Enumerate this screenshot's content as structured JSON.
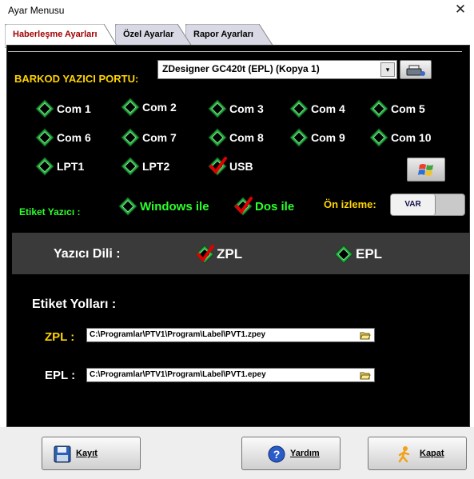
{
  "window": {
    "title": "Ayar Menusu",
    "close_glyph": "✕"
  },
  "tabs": [
    {
      "label": "Haberleşme Ayarları"
    },
    {
      "label": "Özel Ayarlar"
    },
    {
      "label": "Rapor Ayarları"
    }
  ],
  "port": {
    "label": "BARKOD YAZICI PORTU:",
    "selected": "ZDesigner GC420t (EPL) (Kopya 1)",
    "dropdown_glyph": "▾"
  },
  "ports": [
    {
      "label": "Com 1",
      "checked": false
    },
    {
      "label": "Com 2",
      "checked": false
    },
    {
      "label": "Com 3",
      "checked": false
    },
    {
      "label": "Com 4",
      "checked": false
    },
    {
      "label": "Com 5",
      "checked": false
    },
    {
      "label": "Com 6",
      "checked": false
    },
    {
      "label": "Com 7",
      "checked": false
    },
    {
      "label": "Com 8",
      "checked": false
    },
    {
      "label": "Com 9",
      "checked": false
    },
    {
      "label": "Com 10",
      "checked": false
    },
    {
      "label": "LPT1",
      "checked": false
    },
    {
      "label": "LPT2",
      "checked": false
    },
    {
      "label": "USB",
      "checked": true
    }
  ],
  "printer_mode": {
    "label": "Etiket Yazıcı :",
    "windows": {
      "label": "Windows ile",
      "checked": false
    },
    "dos": {
      "label": "Dos ile",
      "checked": true
    }
  },
  "preview": {
    "label": "Ön izleme:",
    "value": "VAR"
  },
  "language": {
    "label": "Yazıcı Dili :",
    "zpl": {
      "label": "ZPL",
      "checked": true
    },
    "epl": {
      "label": "EPL",
      "checked": false
    }
  },
  "paths": {
    "title": "Etiket Yolları :",
    "zpl_label": "ZPL :",
    "zpl_value": "C:\\Programlar\\PTV1\\Program\\Label\\PVT1.zpey",
    "epl_label": "EPL :",
    "epl_value": "C:\\Programlar\\PTV1\\Program\\Label\\PVT1.epey"
  },
  "buttons": {
    "save": "Kayıt",
    "help": "Yardım",
    "close": "Kapat"
  },
  "colors": {
    "panel": "#000000",
    "yellow": "#ffd400",
    "green": "#2cff2c",
    "active_tab_text": "#a00000",
    "diamond": "#1fa83a",
    "check": "#e00000"
  },
  "icons": [
    "print-icon",
    "windows-logo-icon",
    "folder-icon",
    "floppy-disk-icon",
    "help-icon",
    "exit-person-icon"
  ]
}
